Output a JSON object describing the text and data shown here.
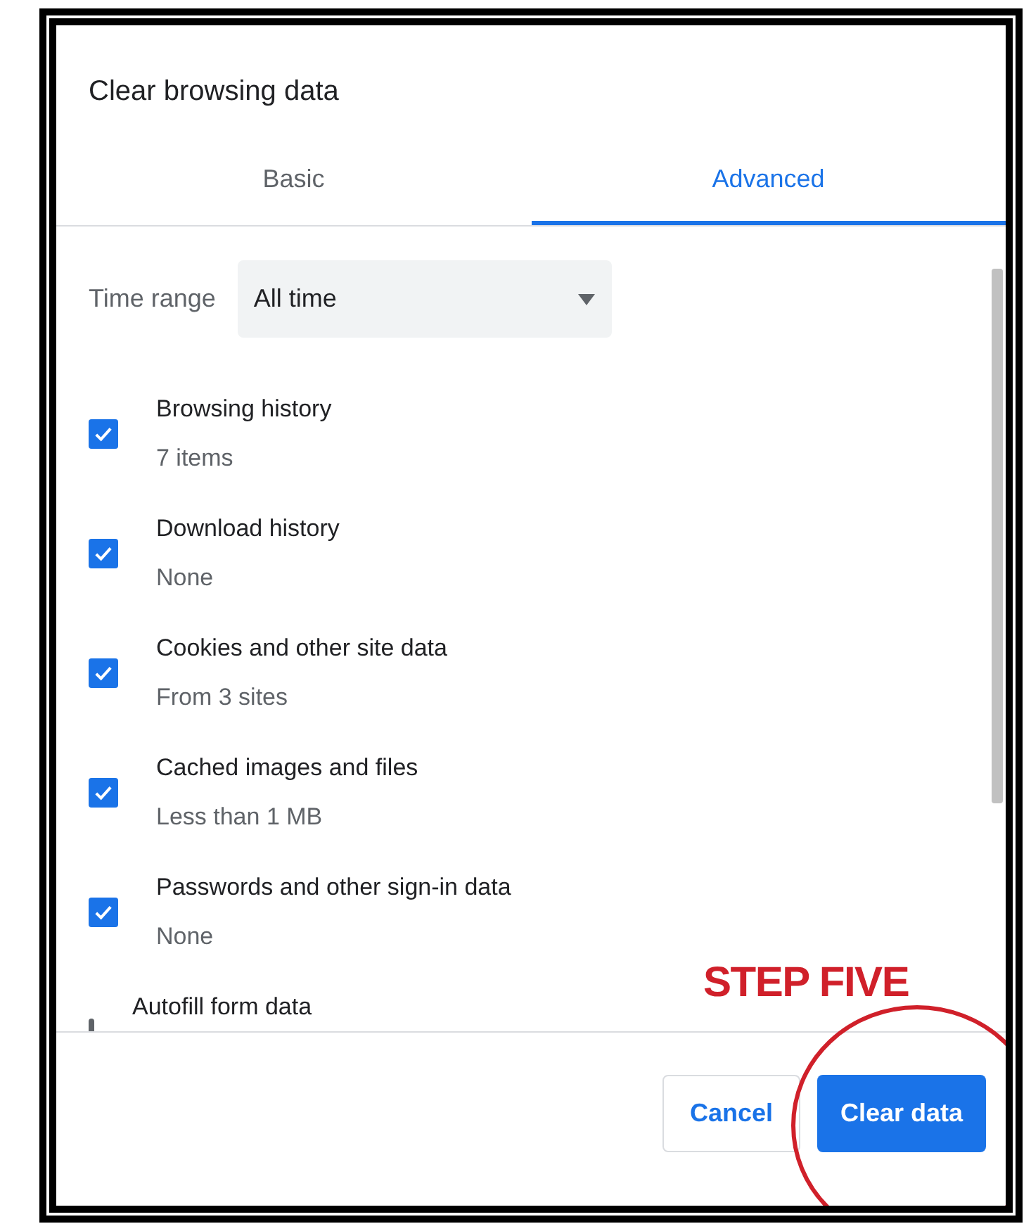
{
  "dialog": {
    "title": "Clear browsing data"
  },
  "tabs": [
    {
      "label": "Basic",
      "selected": false
    },
    {
      "label": "Advanced",
      "selected": true
    }
  ],
  "time_range": {
    "label": "Time range",
    "value": "All time"
  },
  "items": [
    {
      "label": "Browsing history",
      "detail": "7 items",
      "checked": true
    },
    {
      "label": "Download history",
      "detail": "None",
      "checked": true
    },
    {
      "label": "Cookies and other site data",
      "detail": "From 3 sites",
      "checked": true
    },
    {
      "label": "Cached images and files",
      "detail": "Less than 1 MB",
      "checked": true
    },
    {
      "label": "Passwords and other sign-in data",
      "detail": "None",
      "checked": true
    },
    {
      "label": "Autofill form data",
      "checked": false
    }
  ],
  "buttons": [
    {
      "label": "Cancel",
      "kind": "secondary"
    },
    {
      "label": "Clear data",
      "kind": "primary"
    }
  ],
  "annotation": {
    "text": "STEP FIVE"
  }
}
